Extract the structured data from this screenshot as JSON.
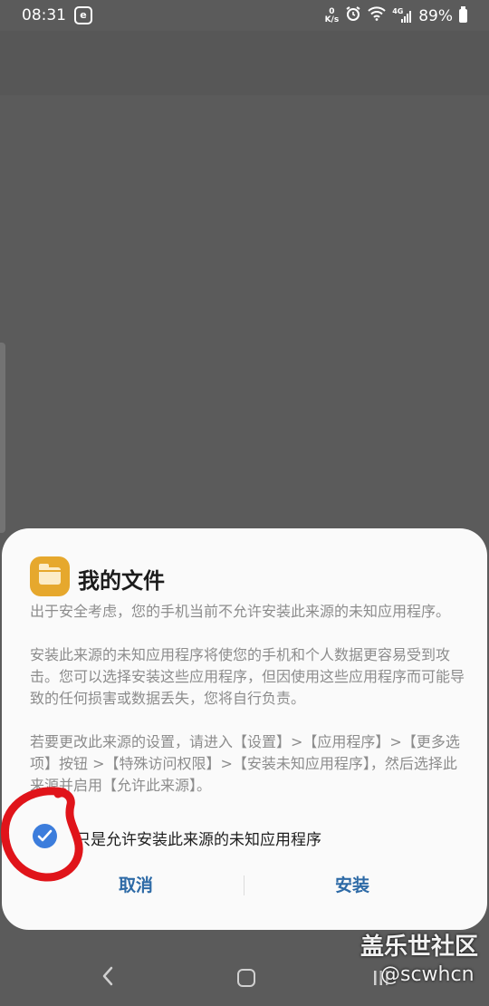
{
  "status_bar": {
    "time": "08:31",
    "e_badge": "e",
    "net_speed_value": "0",
    "net_speed_unit": "K/s",
    "signal_label": "4G",
    "battery": "89%"
  },
  "dialog": {
    "app_name": "我的文件",
    "paragraph1": "出于安全考虑，您的手机当前不允许安装此来源的未知应用程序。",
    "paragraph2": "安装此来源的未知应用程序将使您的手机和个人数据更容易受到攻击。您可以选择安装这些应用程序，但因使用这些应用程序而可能导致的任何损害或数据丢失，您将自行负责。",
    "paragraph3": "若要更改此来源的设置，请进入【设置】>【应用程序】>【更多选项】按钮 >【特殊访问权限】>【安装未知应用程序】，然后选择此来源并启用【允许此来源】。",
    "checkbox_label": "只是允许安装此来源的未知应用程序",
    "checkbox_checked": true,
    "cancel_label": "取消",
    "install_label": "安装"
  },
  "watermark": {
    "line1": "盖乐世社区",
    "line2": "@scwhcn"
  },
  "colors": {
    "accent": "#2d6aa6",
    "checkbox": "#3c7ddc",
    "app_icon": "#e6a82d",
    "annotation": "#e0141a"
  },
  "icons": [
    "alarm-icon",
    "wifi-icon",
    "signal-icon",
    "battery-icon",
    "folder-icon",
    "check-icon",
    "back-icon",
    "home-icon",
    "recent-apps-icon"
  ]
}
